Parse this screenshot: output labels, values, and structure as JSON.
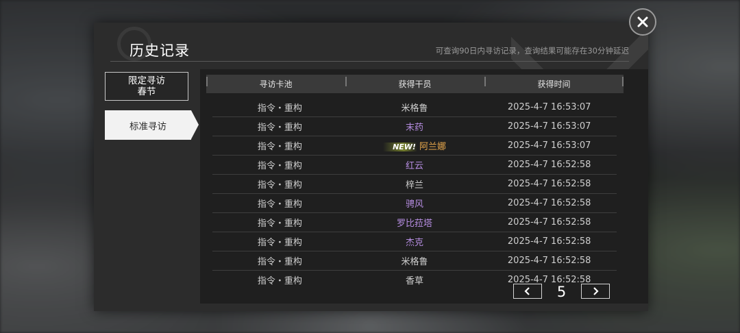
{
  "header": {
    "title": "历史记录",
    "subtitle": "可查询90日内寻访记录，查询结果可能存在30分钟延迟"
  },
  "tabs": [
    {
      "line1": "限定寻访",
      "line2": "春节",
      "selected": false
    },
    {
      "label": "标准寻访",
      "selected": true
    }
  ],
  "table": {
    "columns": [
      "寻访卡池",
      "获得干员",
      "获得时间"
    ],
    "rows": [
      {
        "pool": "指令・重构",
        "operator": "米格鲁",
        "time": "2025-4-7 16:53:07",
        "color": "#cfcfcf",
        "new": ""
      },
      {
        "pool": "指令・重构",
        "operator": "末药",
        "time": "2025-4-7 16:53:07",
        "color": "#b58ce0",
        "new": ""
      },
      {
        "pool": "指令・重构",
        "operator": "阿兰娜",
        "time": "2025-4-7 16:53:07",
        "color": "#e8a84c",
        "new": "NEW!"
      },
      {
        "pool": "指令・重构",
        "operator": "红云",
        "time": "2025-4-7 16:52:58",
        "color": "#b58ce0",
        "new": ""
      },
      {
        "pool": "指令・重构",
        "operator": "梓兰",
        "time": "2025-4-7 16:52:58",
        "color": "#cfcfcf",
        "new": ""
      },
      {
        "pool": "指令・重构",
        "operator": "骋风",
        "time": "2025-4-7 16:52:58",
        "color": "#b58ce0",
        "new": ""
      },
      {
        "pool": "指令・重构",
        "operator": "罗比菈塔",
        "time": "2025-4-7 16:52:58",
        "color": "#b58ce0",
        "new": ""
      },
      {
        "pool": "指令・重构",
        "operator": "杰克",
        "time": "2025-4-7 16:52:58",
        "color": "#b58ce0",
        "new": ""
      },
      {
        "pool": "指令・重构",
        "operator": "米格鲁",
        "time": "2025-4-7 16:52:58",
        "color": "#cfcfcf",
        "new": ""
      },
      {
        "pool": "指令・重构",
        "operator": "香草",
        "time": "2025-4-7 16:52:58",
        "color": "#cfcfcf",
        "new": ""
      }
    ]
  },
  "pager": {
    "page": "5",
    "prev_icon": "chevron-left-icon",
    "next_icon": "chevron-right-icon"
  },
  "close_icon": "close-icon"
}
